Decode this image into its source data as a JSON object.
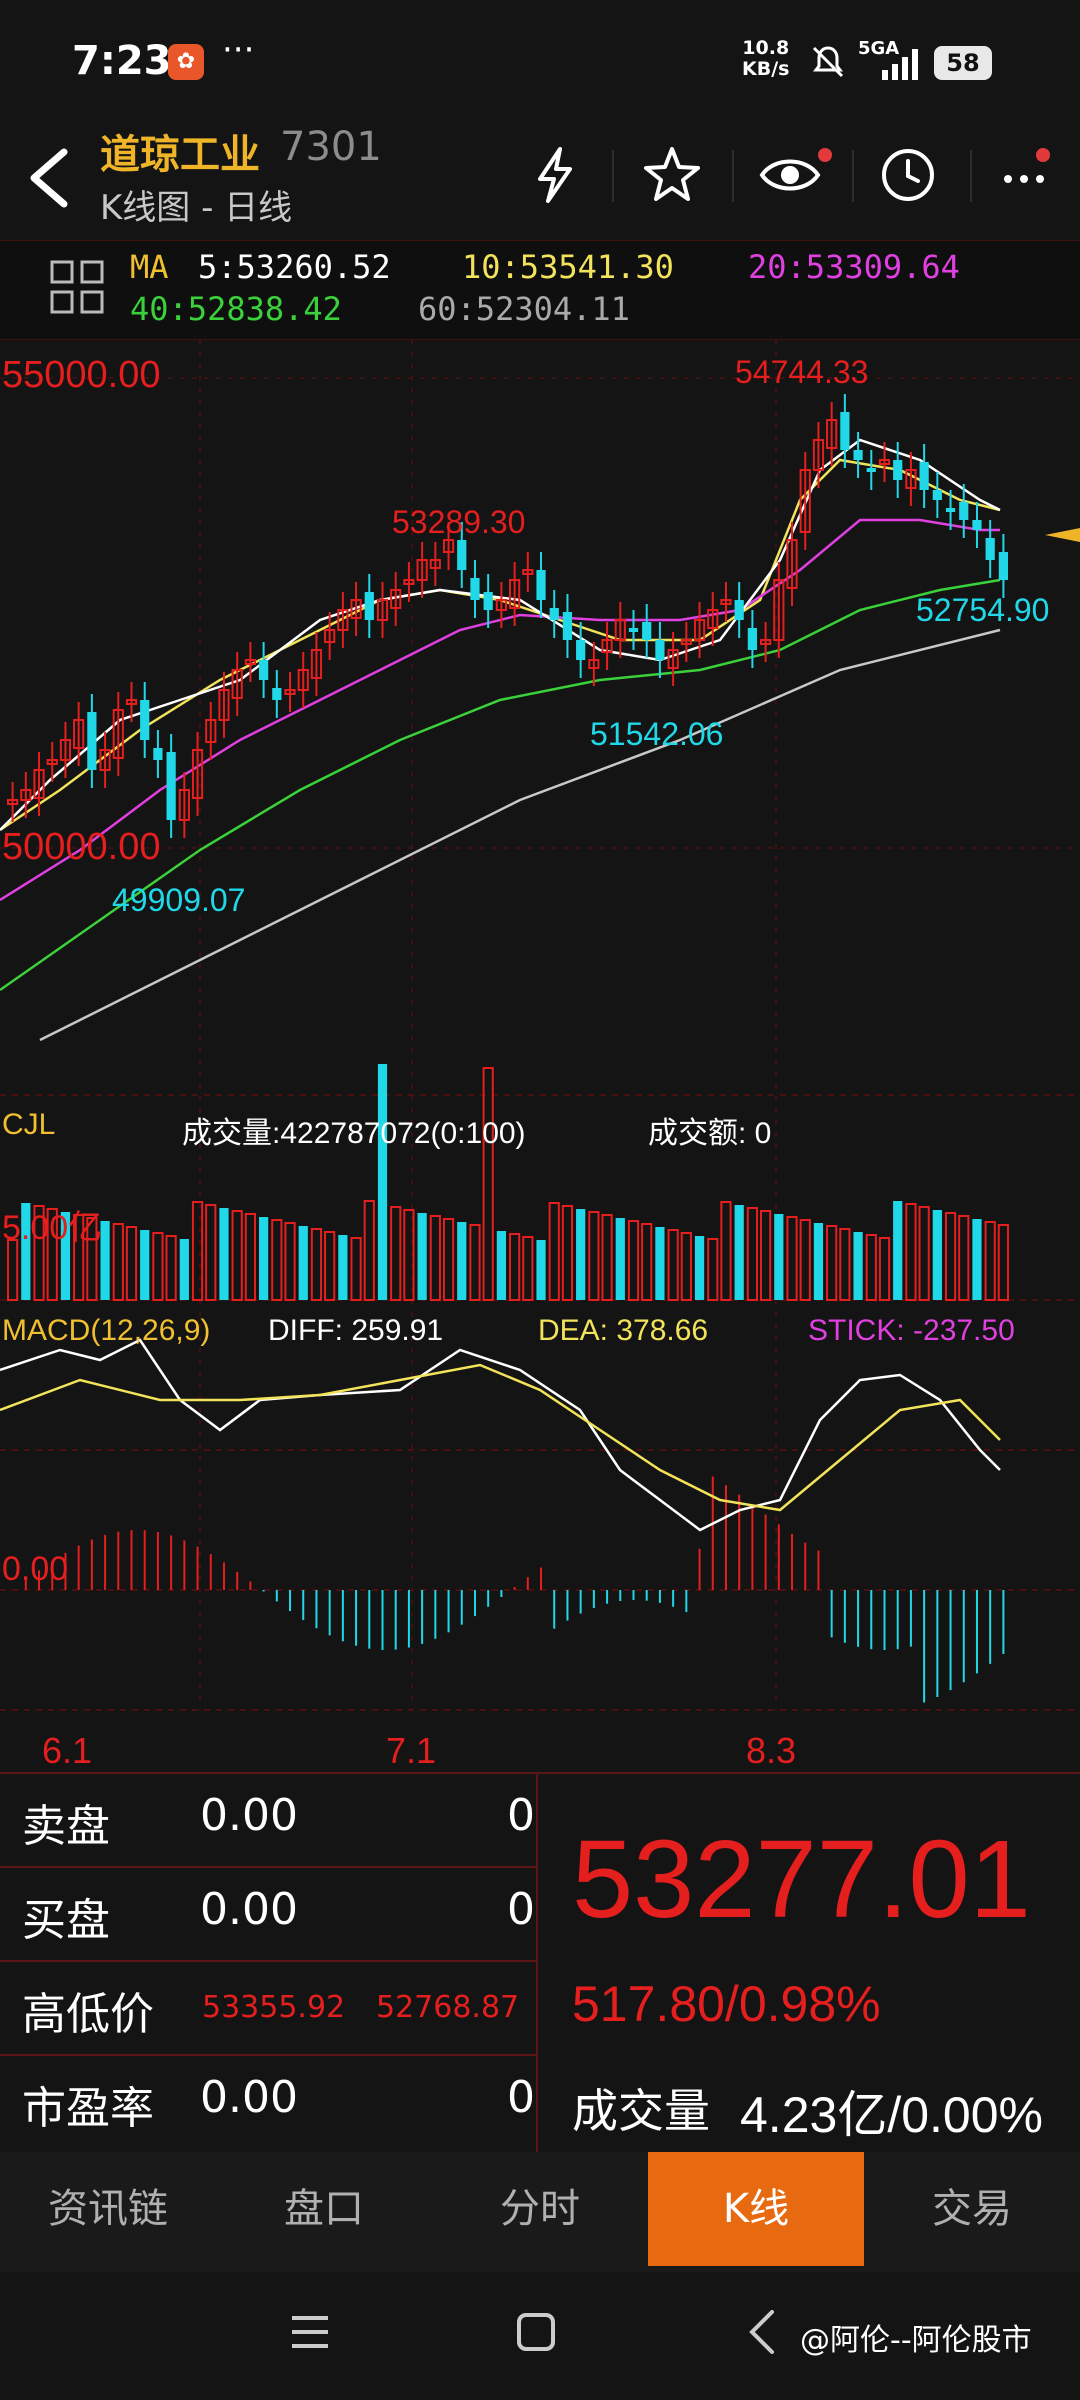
{
  "status_bar": {
    "time": "7:23",
    "net_speed_value": "10.8",
    "net_speed_unit": "KB/s",
    "signal_label": "5GA",
    "battery": "58"
  },
  "header": {
    "stock_name": "道琼工业",
    "stock_code": "7301",
    "chart_kind": "K线图 - 日线",
    "icons": [
      "flash-icon",
      "star-icon",
      "eye-icon",
      "clock-icon",
      "more-icon"
    ]
  },
  "ma_bar": {
    "ma_label": "MA",
    "ma5": "5:53260.52",
    "ma10": "10:53541.30",
    "ma20": "20:53309.64",
    "ma40": "40:52838.42",
    "ma60": "60:52304.11",
    "colors": {
      "ma5": "#ffffff",
      "ma10": "#f2e35a",
      "ma20": "#e040e0",
      "ma40": "#3ad13a",
      "ma60": "#c8c8c8"
    }
  },
  "kline": {
    "price_top": "55000.00",
    "price_bottom": "50000.00",
    "high_label": "54744.33",
    "peak_label": "53289.30",
    "low_label_1": "49909.07",
    "low_label_2": "51542.06",
    "last_low_label": "52754.90"
  },
  "volume_panel": {
    "name": "CJL",
    "volume_text": "成交量:422787072(0:100)",
    "amount_text": "成交额: 0",
    "scale_label": "5.00亿"
  },
  "macd_panel": {
    "name": "MACD(12,26,9)",
    "diff": "DIFF: 259.91",
    "dea": "DEA: 378.66",
    "stick": "STICK: -237.50",
    "zero_label": "0.00"
  },
  "date_axis": [
    "6.1",
    "7.1",
    "8.3"
  ],
  "quote_panel": {
    "sell_label": "卖盘",
    "sell_price": "0.00",
    "sell_qty": "0",
    "buy_label": "买盘",
    "buy_price": "0.00",
    "buy_qty": "0",
    "hilo_label": "高低价",
    "high": "53355.92",
    "low": "52768.87",
    "pe_label": "市盈率",
    "pe_value": "0.00",
    "pe_qty": "0",
    "last_price": "53277.01",
    "change": "517.80/0.98%",
    "volume_label": "成交量",
    "volume_value": "4.23亿/0.00%"
  },
  "tabs": [
    {
      "label": "资讯链",
      "active": false
    },
    {
      "label": "盘口",
      "active": false
    },
    {
      "label": "分时",
      "active": false
    },
    {
      "label": "K线",
      "active": true
    },
    {
      "label": "交易",
      "active": false
    }
  ],
  "watermark": "@阿伦--阿伦股市",
  "colors": {
    "up": "#e51e1e",
    "down": "#20d8e8",
    "accent_tab": "#e86a10",
    "title": "#f0b429"
  }
}
